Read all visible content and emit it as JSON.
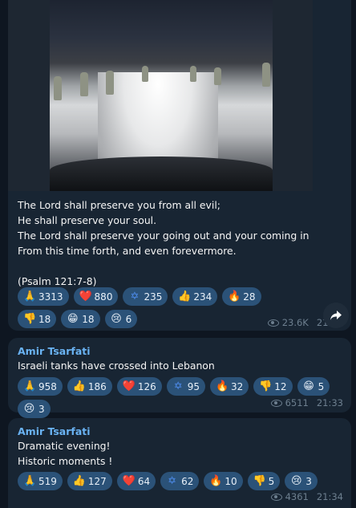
{
  "post1": {
    "lines": [
      "The Lord shall preserve you from all evil;",
      "He shall preserve your soul.",
      "The Lord shall preserve your going out and your coming in",
      "From this time forth, and even forevermore.",
      "",
      "(Psalm 121:7-8)"
    ],
    "reactions": [
      {
        "emoji": "🙏",
        "count": "3313"
      },
      {
        "emoji": "❤️",
        "count": "880"
      },
      {
        "emoji": "✡",
        "count": "235"
      },
      {
        "emoji": "👍",
        "count": "234"
      },
      {
        "emoji": "🔥",
        "count": "28"
      },
      {
        "emoji": "👎",
        "count": "18"
      },
      {
        "emoji": "😁",
        "count": "18"
      },
      {
        "emoji": "😢",
        "count": "6"
      }
    ],
    "views": "23.6K",
    "time": "21:18"
  },
  "post2": {
    "sender": "Amir Tsarfati",
    "lines": [
      "Israeli tanks have crossed into Lebanon"
    ],
    "reactions": [
      {
        "emoji": "🙏",
        "count": "958"
      },
      {
        "emoji": "👍",
        "count": "186"
      },
      {
        "emoji": "❤️",
        "count": "126"
      },
      {
        "emoji": "✡",
        "count": "95"
      },
      {
        "emoji": "🔥",
        "count": "32"
      },
      {
        "emoji": "👎",
        "count": "12"
      },
      {
        "emoji": "😁",
        "count": "5"
      },
      {
        "emoji": "😢",
        "count": "3"
      }
    ],
    "views": "6511",
    "time": "21:33"
  },
  "post3": {
    "sender": "Amir Tsarfati",
    "lines": [
      "Dramatic evening!",
      "Historic moments !"
    ],
    "reactions": [
      {
        "emoji": "🙏",
        "count": "519"
      },
      {
        "emoji": "👍",
        "count": "127"
      },
      {
        "emoji": "❤️",
        "count": "64"
      },
      {
        "emoji": "✡",
        "count": "62"
      },
      {
        "emoji": "🔥",
        "count": "10"
      },
      {
        "emoji": "👎",
        "count": "5"
      },
      {
        "emoji": "😢",
        "count": "3"
      }
    ],
    "views": "4361",
    "time": "21:34"
  },
  "icons": {
    "share": "share-icon",
    "views": "eye-icon"
  }
}
